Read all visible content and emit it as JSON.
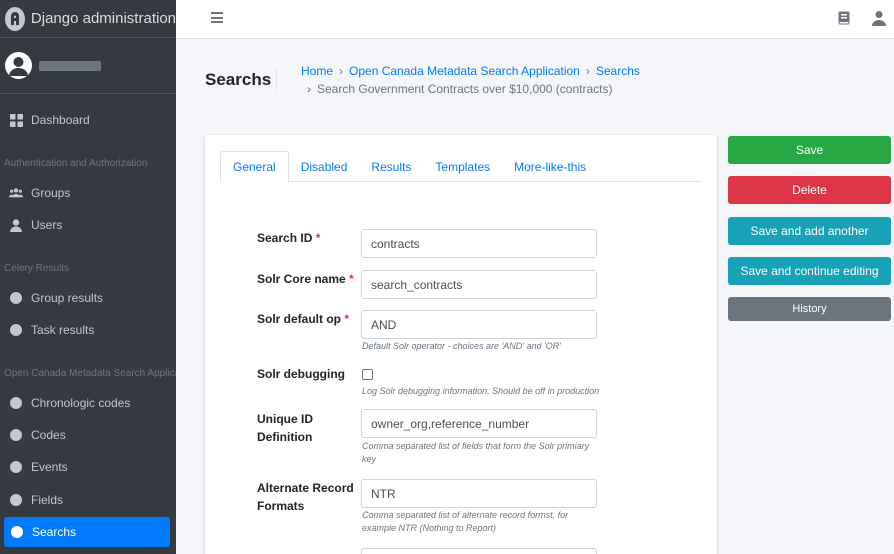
{
  "sidebar": {
    "brand": "Django administration",
    "dashboard": "Dashboard",
    "sections": [
      {
        "header": "Authentication and Authorization",
        "items": [
          "Groups",
          "Users"
        ]
      },
      {
        "header": "Celery Results",
        "items": [
          "Group results",
          "Task results"
        ]
      },
      {
        "header": "Open Canada Metadata Search Applica",
        "items": [
          "Chronologic codes",
          "Codes",
          "Events",
          "Fields",
          "Searchs"
        ]
      }
    ],
    "active_item": "Searchs"
  },
  "page": {
    "title": "Searchs",
    "breadcrumb": [
      "Home",
      "Open Canada Metadata Search Application",
      "Searchs",
      "Search Government Contracts over $10,000 (contracts)"
    ]
  },
  "tabs": [
    "General",
    "Disabled",
    "Results",
    "Templates",
    "More-like-this"
  ],
  "active_tab": "General",
  "form": {
    "search_id": {
      "label": "Search ID",
      "required": "*",
      "value": "contracts"
    },
    "solr_core": {
      "label": "Solr Core name",
      "required": "*",
      "value": "search_contracts"
    },
    "solr_default_op": {
      "label": "Solr default op",
      "required": "*",
      "value": "AND",
      "help": "Default Solr operator - choices are 'AND' and 'OR'"
    },
    "solr_debugging": {
      "label": "Solr debugging",
      "checked": false,
      "help": "Log Solr debugging information, Should be off in production"
    },
    "unique_id": {
      "label": "Unique ID Definition",
      "value": "owner_org,reference_number",
      "help": "Comma separated list of fields that form the Solr primiary key"
    },
    "alt_formats": {
      "label": "Alternate Record Formats",
      "value": "NTR",
      "help": "Comma separated list of alternate record formst, for example NTR (Nothing to Report)"
    }
  },
  "actions": {
    "save": "Save",
    "delete": "Delete",
    "save_add": "Save and add another",
    "save_continue": "Save and continue editing",
    "history": "History"
  },
  "colors": {
    "sidebar": "#343a40",
    "active": "#007bff",
    "save": "#28a745",
    "delete": "#dc3545",
    "info": "#17a2b8",
    "secondary": "#6c757d"
  }
}
